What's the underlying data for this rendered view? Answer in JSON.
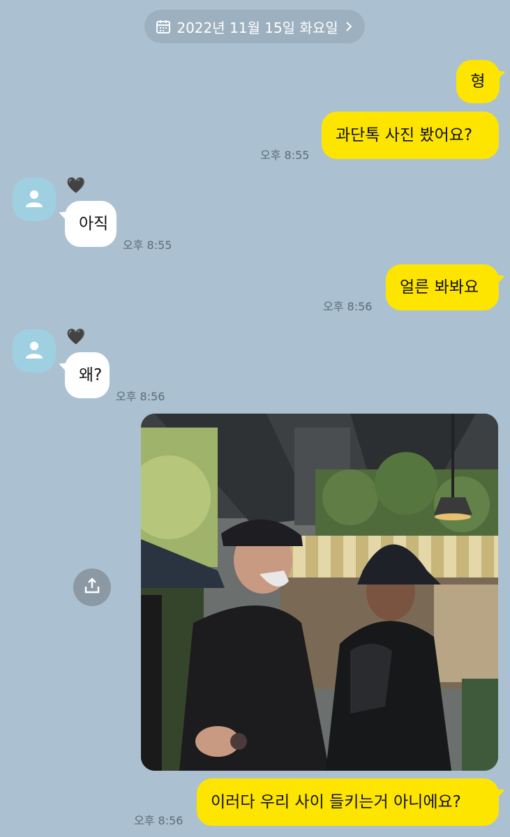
{
  "date_bar": {
    "label": "2022년 11월 15일 화요일"
  },
  "messages": [
    {
      "text": "형",
      "time": ""
    },
    {
      "text": "과단톡 사진 봤어요?",
      "time": "오후 8:55"
    },
    {
      "text": "아직",
      "time": "오후 8:55"
    },
    {
      "text": "얼른 봐봐요",
      "time": "오후 8:56"
    },
    {
      "text": "왜?",
      "time": "오후 8:56"
    },
    {
      "text": "이러다 우리 사이 들키는거 아니에요?",
      "time": "오후 8:56"
    }
  ],
  "contact": {
    "name_emoji": "🖤"
  },
  "icons": [
    "calendar-icon",
    "chevron-right-icon",
    "person-icon",
    "share-icon"
  ],
  "colors": {
    "background": "#abc1d1",
    "my_bubble": "#fee500",
    "their_bubble": "#ffffff"
  }
}
